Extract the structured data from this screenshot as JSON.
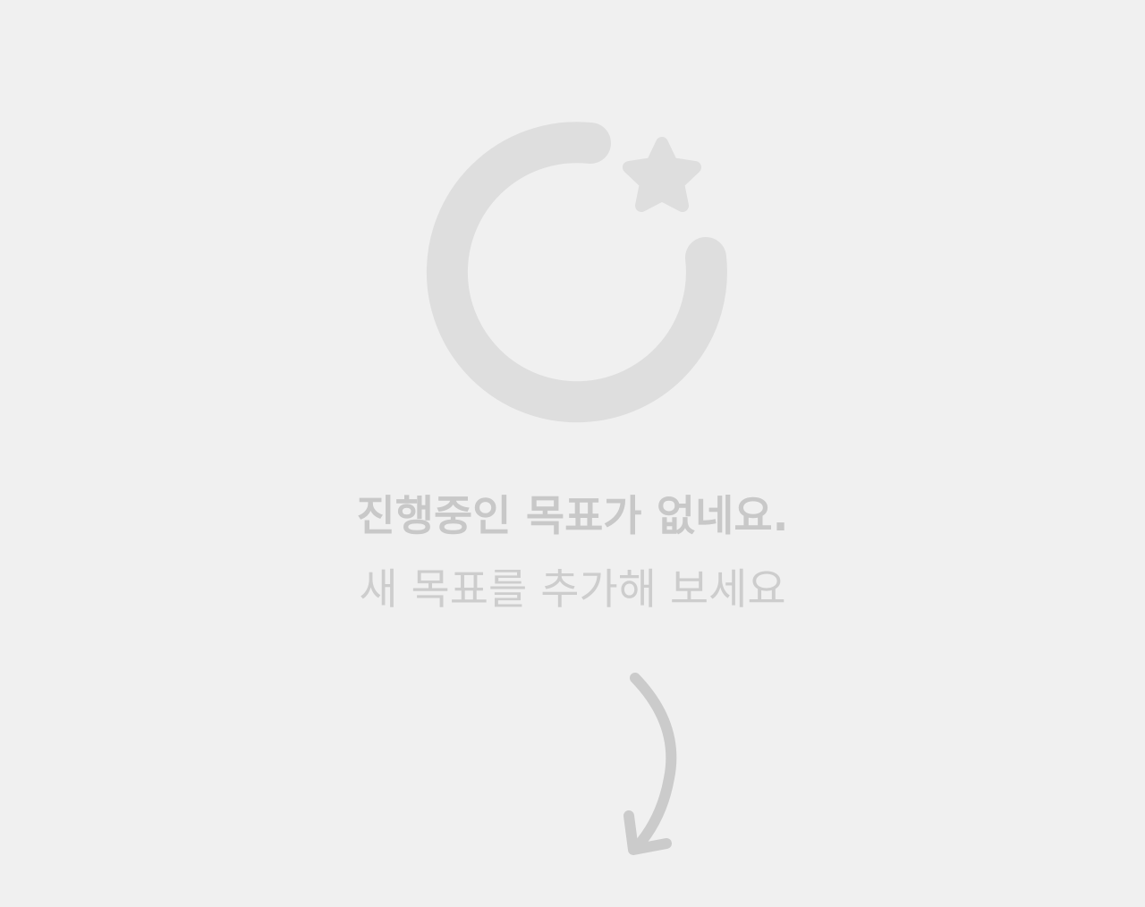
{
  "empty_state": {
    "icon": "progress-ring-star-icon",
    "title": "진행중인 목표가 없네요.",
    "subtitle": "새 목표를 추가해 보세요",
    "arrow_icon": "curved-arrow-down-icon"
  },
  "colors": {
    "background": "#f0f0f0",
    "icon": "#dedede",
    "title": "#c8c8c8",
    "arrow": "#cbcbcb"
  }
}
